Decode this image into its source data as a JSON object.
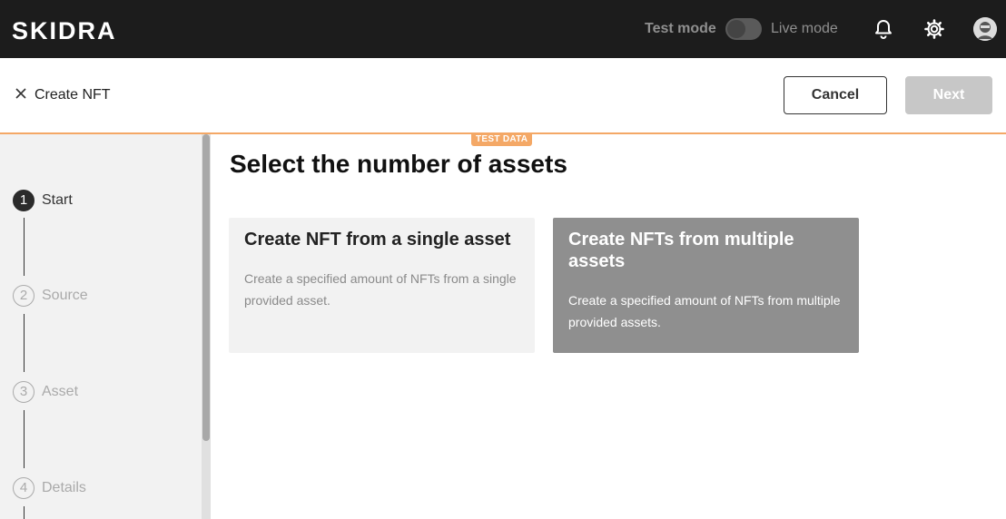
{
  "app": {
    "logo_text": "SKIDRA",
    "mode_test_label": "Test mode",
    "mode_live_label": "Live mode",
    "icons": [
      "bell-icon",
      "gear-icon",
      "avatar"
    ]
  },
  "subheader": {
    "title": "Create NFT",
    "cancel_label": "Cancel",
    "next_label": "Next",
    "badge": "TEST DATA"
  },
  "steps": [
    {
      "num": "1",
      "label": "Start",
      "state": "active"
    },
    {
      "num": "2",
      "label": "Source",
      "state": "inactive"
    },
    {
      "num": "3",
      "label": "Asset",
      "state": "inactive"
    },
    {
      "num": "4",
      "label": "Details",
      "state": "inactive"
    }
  ],
  "main": {
    "title": "Select the number of assets",
    "cards": [
      {
        "title": "Create NFT from a single asset",
        "description": "Create a specified amount of NFTs from a single provided asset."
      },
      {
        "title": "Create NFTs from multiple assets",
        "description": "Create a specified amount of NFTs from multiple provided assets."
      }
    ]
  },
  "colors": {
    "topbar": "#1c1c1c",
    "accent": "#f4a866",
    "card_selected": "#8f8f8f",
    "card_default": "#f2f2f2"
  }
}
